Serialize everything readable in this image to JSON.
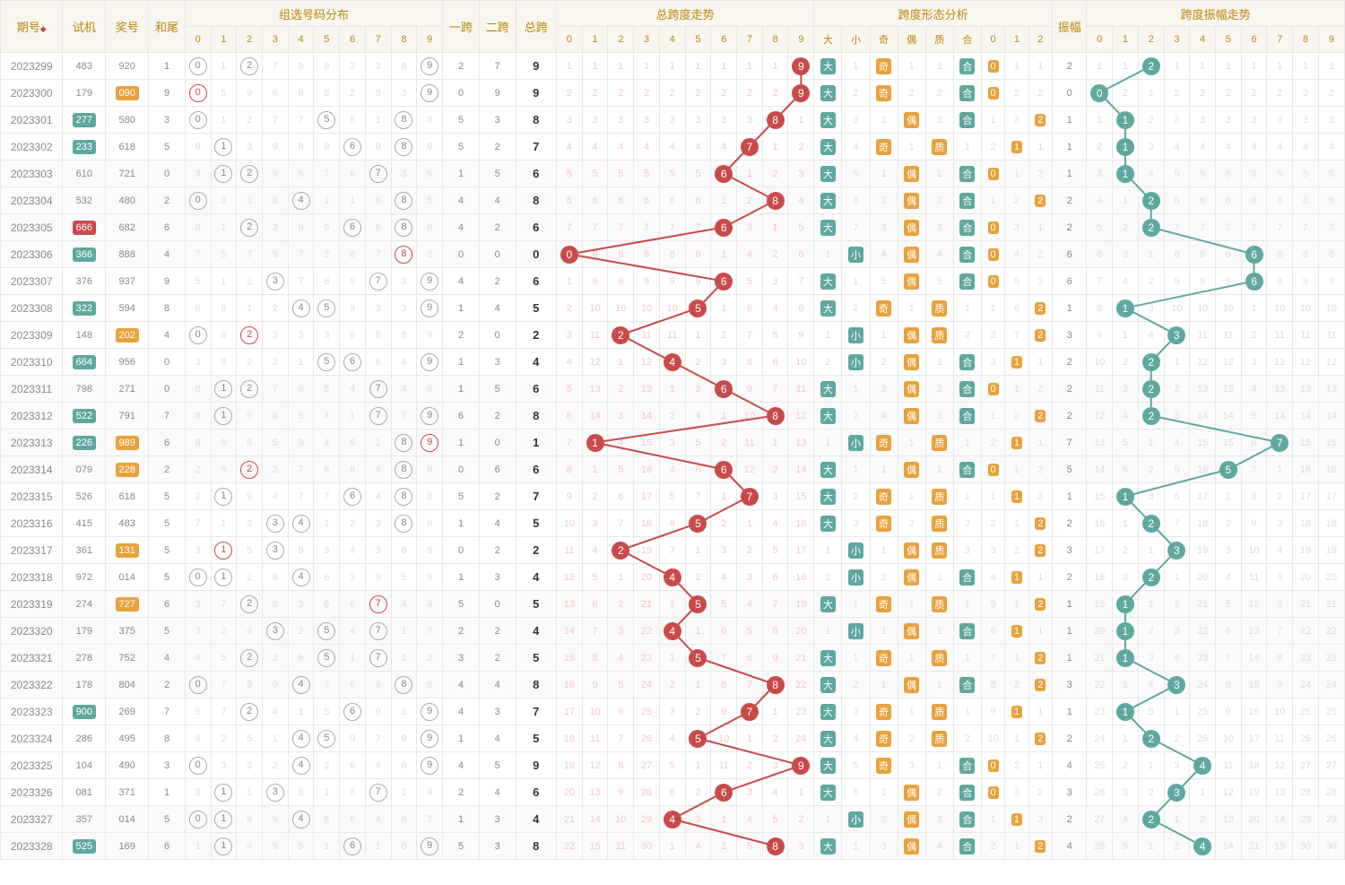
{
  "headers": {
    "issue": "期号",
    "test": "试机",
    "award": "奖号",
    "tail": "和尾",
    "zuxuan": "组选号码分布",
    "span1": "一跨",
    "span2": "二跨",
    "spanT": "总跨",
    "trend": "总跨度走势",
    "shape": "跨度形态分析",
    "amp": "振幅",
    "ampTrend": "跨度振幅走势",
    "da": "大",
    "xiao": "小",
    "qi": "奇",
    "ou": "偶",
    "zhi": "质",
    "he": "合"
  },
  "chart_data": {
    "type": "table",
    "columns": [
      "issue",
      "test",
      "test_style",
      "award",
      "award_style",
      "tail",
      "zuxuan_digits",
      "span1",
      "span2",
      "spanT",
      "shape_daxiao",
      "shape_qiou",
      "shape_zhihe",
      "shape_012",
      "amp",
      "amp_ball"
    ],
    "rows": [
      [
        "2023299",
        "483",
        "",
        "920",
        "",
        "1",
        [
          9,
          2,
          0
        ],
        "2",
        "7",
        "9",
        "大",
        "奇",
        "合",
        0,
        "2",
        2
      ],
      [
        "2023300",
        "179",
        "",
        "090",
        "o",
        "9",
        [
          0,
          9,
          0
        ],
        "0",
        "9",
        "9",
        "大",
        "奇",
        "合",
        0,
        "0",
        0
      ],
      [
        "2023301",
        "277",
        "t",
        "580",
        "",
        "3",
        [
          0,
          5,
          8
        ],
        "5",
        "3",
        "8",
        "大",
        "偶",
        "合",
        2,
        "1",
        1
      ],
      [
        "2023302",
        "233",
        "t",
        "618",
        "",
        "5",
        [
          1,
          6,
          8
        ],
        "5",
        "2",
        "7",
        "大",
        "奇",
        "质",
        1,
        "1",
        1
      ],
      [
        "2023303",
        "610",
        "",
        "721",
        "",
        "0",
        [
          1,
          2,
          7
        ],
        "1",
        "5",
        "6",
        "大",
        "偶",
        "合",
        0,
        "1",
        1
      ],
      [
        "2023304",
        "532",
        "",
        "480",
        "",
        "2",
        [
          0,
          4,
          8
        ],
        "4",
        "4",
        "8",
        "大",
        "偶",
        "合",
        2,
        "2",
        2
      ],
      [
        "2023305",
        "666",
        "r",
        "682",
        "",
        "6",
        [
          2,
          6,
          8
        ],
        "4",
        "2",
        "6",
        "大",
        "偶",
        "合",
        0,
        "2",
        2
      ],
      [
        "2023306",
        "366",
        "t",
        "888",
        "",
        "4",
        [
          8,
          8,
          8
        ],
        "0",
        "0",
        "0",
        "小",
        "偶",
        "合",
        0,
        "6",
        6
      ],
      [
        "2023307",
        "376",
        "",
        "937",
        "",
        "9",
        [
          3,
          7,
          9
        ],
        "4",
        "2",
        "6",
        "大",
        "偶",
        "合",
        0,
        "6",
        6
      ],
      [
        "2023308",
        "322",
        "t",
        "594",
        "",
        "8",
        [
          4,
          5,
          9
        ],
        "1",
        "4",
        "5",
        "大",
        "奇",
        "质",
        2,
        "1",
        1
      ],
      [
        "2023309",
        "148",
        "",
        "202",
        "o",
        "4",
        [
          0,
          2,
          2
        ],
        "2",
        "0",
        "2",
        "小",
        "偶",
        "质",
        2,
        "3",
        3
      ],
      [
        "2023310",
        "664",
        "t",
        "956",
        "",
        "0",
        [
          5,
          6,
          9
        ],
        "1",
        "3",
        "4",
        "小",
        "偶",
        "合",
        1,
        "2",
        2
      ],
      [
        "2023311",
        "798",
        "",
        "271",
        "",
        "0",
        [
          1,
          2,
          7
        ],
        "1",
        "5",
        "6",
        "大",
        "偶",
        "合",
        0,
        "2",
        2
      ],
      [
        "2023312",
        "522",
        "t",
        "791",
        "",
        "7",
        [
          1,
          7,
          9
        ],
        "6",
        "2",
        "8",
        "大",
        "偶",
        "合",
        2,
        "2",
        2
      ],
      [
        "2023313",
        "226",
        "t",
        "989",
        "o",
        "6",
        [
          8,
          9,
          9
        ],
        "1",
        "0",
        "1",
        "小",
        "奇",
        "质",
        1,
        "7",
        7
      ],
      [
        "2023314",
        "079",
        "",
        "228",
        "o",
        "2",
        [
          2,
          2,
          8
        ],
        "0",
        "6",
        "6",
        "大",
        "偶",
        "合",
        0,
        "5",
        5
      ],
      [
        "2023315",
        "526",
        "",
        "618",
        "",
        "5",
        [
          1,
          6,
          8
        ],
        "5",
        "2",
        "7",
        "大",
        "奇",
        "质",
        1,
        "1",
        1
      ],
      [
        "2023316",
        "415",
        "",
        "483",
        "",
        "5",
        [
          3,
          4,
          8
        ],
        "1",
        "4",
        "5",
        "大",
        "奇",
        "质",
        2,
        "2",
        2
      ],
      [
        "2023317",
        "361",
        "",
        "131",
        "o",
        "5",
        [
          1,
          1,
          3
        ],
        "0",
        "2",
        "2",
        "小",
        "偶",
        "质",
        2,
        "3",
        3
      ],
      [
        "2023318",
        "972",
        "",
        "014",
        "",
        "5",
        [
          0,
          1,
          4
        ],
        "1",
        "3",
        "4",
        "小",
        "偶",
        "合",
        1,
        "2",
        2
      ],
      [
        "2023319",
        "274",
        "",
        "727",
        "o",
        "6",
        [
          2,
          7,
          7
        ],
        "5",
        "0",
        "5",
        "大",
        "奇",
        "质",
        2,
        "1",
        1
      ],
      [
        "2023320",
        "179",
        "",
        "375",
        "",
        "5",
        [
          3,
          5,
          7
        ],
        "2",
        "2",
        "4",
        "小",
        "偶",
        "合",
        1,
        "1",
        1
      ],
      [
        "2023321",
        "278",
        "",
        "752",
        "",
        "4",
        [
          2,
          5,
          7
        ],
        "3",
        "2",
        "5",
        "大",
        "奇",
        "质",
        2,
        "1",
        1
      ],
      [
        "2023322",
        "178",
        "",
        "804",
        "",
        "2",
        [
          0,
          4,
          8
        ],
        "4",
        "4",
        "8",
        "大",
        "偶",
        "合",
        2,
        "3",
        3
      ],
      [
        "2023323",
        "900",
        "t",
        "269",
        "",
        "7",
        [
          2,
          6,
          9
        ],
        "4",
        "3",
        "7",
        "大",
        "奇",
        "质",
        1,
        "1",
        1
      ],
      [
        "2023324",
        "286",
        "",
        "495",
        "",
        "8",
        [
          4,
          5,
          9
        ],
        "1",
        "4",
        "5",
        "大",
        "奇",
        "质",
        2,
        "2",
        2
      ],
      [
        "2023325",
        "104",
        "",
        "490",
        "",
        "3",
        [
          0,
          4,
          9
        ],
        "4",
        "5",
        "9",
        "大",
        "奇",
        "合",
        0,
        "4",
        4
      ],
      [
        "2023326",
        "081",
        "",
        "371",
        "",
        "1",
        [
          1,
          3,
          7
        ],
        "2",
        "4",
        "6",
        "大",
        "偶",
        "合",
        0,
        "3",
        3
      ],
      [
        "2023327",
        "357",
        "",
        "014",
        "",
        "5",
        [
          0,
          1,
          4
        ],
        "1",
        "3",
        "4",
        "小",
        "偶",
        "合",
        1,
        "2",
        2
      ],
      [
        "2023328",
        "525",
        "t",
        "169",
        "",
        "6",
        [
          1,
          6,
          9
        ],
        "5",
        "3",
        "8",
        "大",
        "偶",
        "合",
        2,
        "4",
        4
      ]
    ]
  }
}
